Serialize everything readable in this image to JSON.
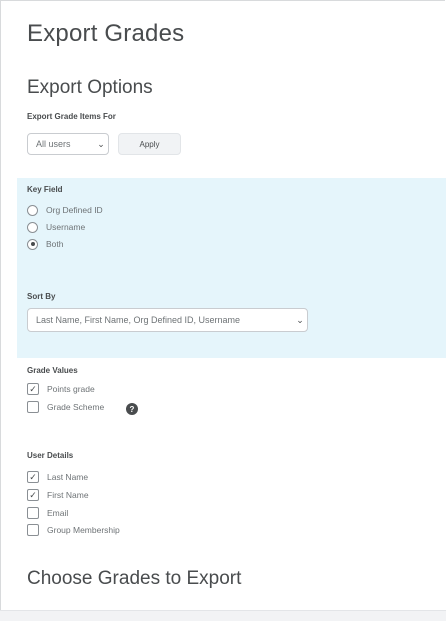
{
  "page": {
    "title": "Export Grades"
  },
  "export_options": {
    "heading": "Export Options",
    "items_for_label": "Export Grade Items For",
    "items_for_value": "All users",
    "apply_label": "Apply"
  },
  "key_field": {
    "label": "Key Field",
    "options": [
      {
        "label": "Org Defined ID",
        "selected": false
      },
      {
        "label": "Username",
        "selected": false
      },
      {
        "label": "Both",
        "selected": true
      }
    ]
  },
  "sort_by": {
    "label": "Sort By",
    "value": "Last Name, First Name, Org Defined ID, Username"
  },
  "grade_values": {
    "label": "Grade Values",
    "options": [
      {
        "label": "Points grade",
        "checked": true
      },
      {
        "label": "Grade Scheme",
        "checked": false
      }
    ],
    "help_glyph": "?"
  },
  "user_details": {
    "label": "User Details",
    "options": [
      {
        "label": "Last Name",
        "checked": true
      },
      {
        "label": "First Name",
        "checked": true
      },
      {
        "label": "Email",
        "checked": false
      },
      {
        "label": "Group Membership",
        "checked": false
      }
    ]
  },
  "choose_grades": {
    "heading": "Choose Grades to Export"
  },
  "glyphs": {
    "chevron": "⌄",
    "check": "✓"
  },
  "colors": {
    "highlight": "#e5f5fb",
    "text": "#494c4e"
  }
}
